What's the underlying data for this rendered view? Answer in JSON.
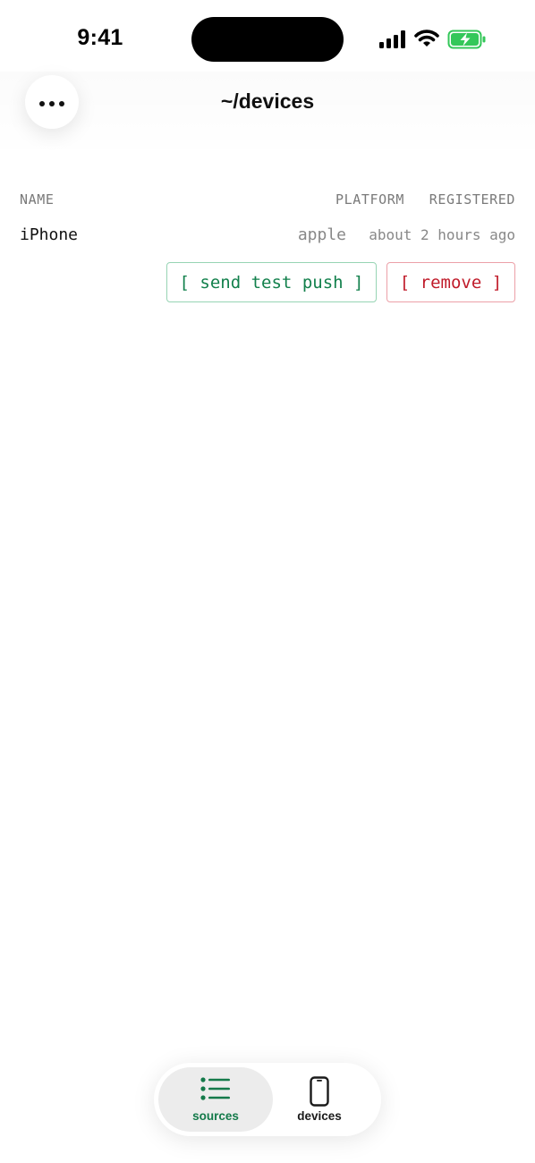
{
  "status_bar": {
    "time": "9:41",
    "icons": [
      "cellular-signal-icon",
      "wifi-icon",
      "battery-charging-icon"
    ]
  },
  "header": {
    "title": "~/devices",
    "menu_icon": "ellipsis-icon"
  },
  "devices_table": {
    "columns": {
      "name": "NAME",
      "platform": "PLATFORM",
      "registered": "REGISTERED"
    },
    "rows": [
      {
        "name": "iPhone",
        "platform": "apple",
        "registered": "about 2 hours ago",
        "actions": {
          "send_test_push": "[ send test push ]",
          "remove": "[ remove ]"
        }
      }
    ]
  },
  "tab_bar": {
    "tabs": [
      {
        "label": "sources",
        "icon": "list-icon",
        "active": true
      },
      {
        "label": "devices",
        "icon": "phone-icon",
        "active": false
      }
    ]
  },
  "colors": {
    "accent_green": "#147a4a",
    "danger_red": "#c01b2a",
    "battery_green": "#34c759"
  }
}
